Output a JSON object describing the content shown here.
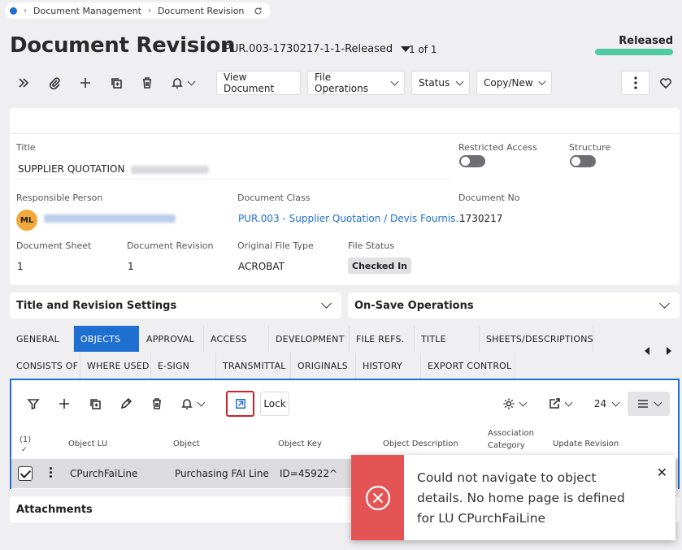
{
  "breadcrumb": {
    "items": [
      "Document Management",
      "Document Revision"
    ]
  },
  "header": {
    "title": "Document Revision",
    "record_id": "PUR.003-1730217-1-1-Released",
    "record_count": "1 of 1",
    "status": "Released",
    "status_color": "#4fc9a0"
  },
  "toolbar": {
    "view_document": "View Document",
    "file_operations": "File Operations",
    "status": "Status",
    "copy_new": "Copy/New"
  },
  "form": {
    "title_label": "Title",
    "title_value": "SUPPLIER QUOTATION",
    "restricted_access_label": "Restricted Access",
    "structure_label": "Structure",
    "responsible_person_label": "Responsible Person",
    "responsible_initials": "ML",
    "document_class_label": "Document Class",
    "document_class_value": "PUR.003 - Supplier Quotation / Devis Fournis...",
    "document_no_label": "Document No",
    "document_no_value": "1730217",
    "document_sheet_label": "Document Sheet",
    "document_sheet_value": "1",
    "document_revision_label": "Document Revision",
    "document_revision_value": "1",
    "original_file_type_label": "Original File Type",
    "original_file_type_value": "ACROBAT",
    "file_status_label": "File Status",
    "file_status_value": "Checked In"
  },
  "groups": {
    "title_revision": "Title and Revision Settings",
    "on_save": "On-Save Operations",
    "attachments": "Attachments"
  },
  "tabs": {
    "row1": [
      "GENERAL",
      "OBJECTS",
      "APPROVAL",
      "ACCESS",
      "DEVELOPMENT",
      "FILE REFS.",
      "TITLE",
      "SHEETS/DESCRIPTIONS"
    ],
    "row2": [
      "CONSISTS OF",
      "WHERE USED",
      "E-SIGN",
      "TRANSMITTAL",
      "ORIGINALS",
      "HISTORY",
      "EXPORT CONTROL"
    ],
    "active": "OBJECTS"
  },
  "objects": {
    "lock_label": "Lock",
    "page_size": "24",
    "selected_count": "(1)",
    "columns": [
      "Object LU",
      "Object",
      "Object Key",
      "Object Description",
      "Association Category",
      "Update Revision"
    ],
    "row": {
      "object_lu": "CPurchFaiLine",
      "object": "Purchasing FAI Line",
      "object_key": "ID=45922^"
    }
  },
  "toast": {
    "message": "Could not navigate to object details. No home page is defined for LU CPurchFaiLine",
    "color": "#e55454"
  }
}
